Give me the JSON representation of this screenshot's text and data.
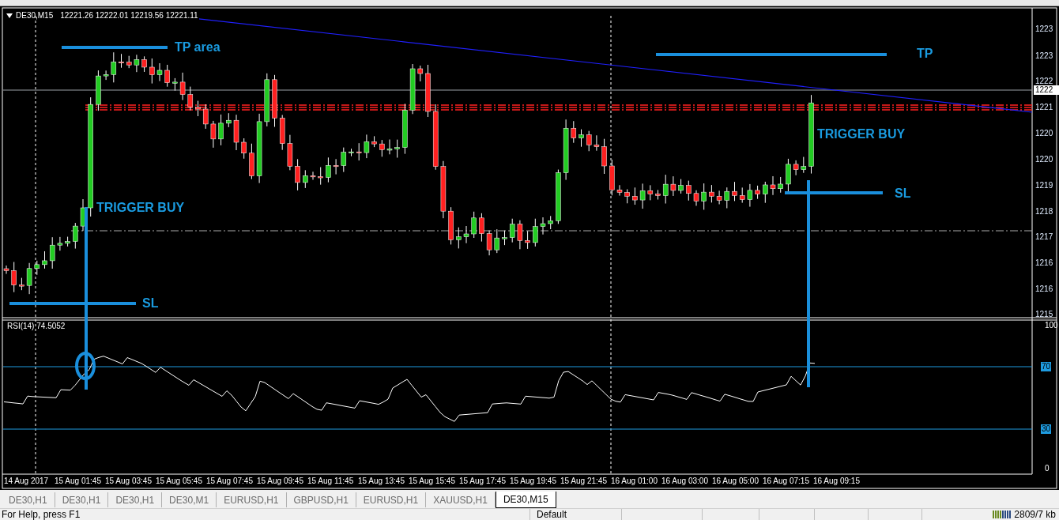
{
  "chart": {
    "symbol": "DE30,M15",
    "ohlc": "12221.26 12222.01 12219.56 12221.11",
    "price_axis": [
      {
        "label": "1223",
        "kind": "tick"
      },
      {
        "label": "1223",
        "kind": "tick"
      },
      {
        "label": "1222",
        "kind": "tick"
      },
      {
        "label": "1222",
        "kind": "current"
      },
      {
        "label": "1221",
        "kind": "tick"
      },
      {
        "label": "1220",
        "kind": "tick"
      },
      {
        "label": "1220",
        "kind": "tick"
      },
      {
        "label": "1219",
        "kind": "tick"
      },
      {
        "label": "1218",
        "kind": "tick"
      },
      {
        "label": "1217",
        "kind": "tick"
      },
      {
        "label": "1216",
        "kind": "tick"
      },
      {
        "label": "1216",
        "kind": "tick"
      },
      {
        "label": "1215",
        "kind": "tick"
      }
    ],
    "annotations": [
      {
        "text": "TP area"
      },
      {
        "text": "TP"
      },
      {
        "text": "TRIGGER BUY"
      },
      {
        "text": "TRIGGER BUY"
      },
      {
        "text": "SL"
      },
      {
        "text": "SL"
      }
    ]
  },
  "indicator": {
    "label": "RSI(14) 74.5052",
    "axis": [
      {
        "label": "100",
        "kind": "plain"
      },
      {
        "label": "70",
        "kind": "level"
      },
      {
        "label": "30",
        "kind": "level"
      },
      {
        "label": "0",
        "kind": "plain"
      }
    ]
  },
  "time_axis": [
    "14 Aug 2017",
    "15 Aug 01:45",
    "15 Aug 03:45",
    "15 Aug 05:45",
    "15 Aug 07:45",
    "15 Aug 09:45",
    "15 Aug 11:45",
    "15 Aug 13:45",
    "15 Aug 15:45",
    "15 Aug 17:45",
    "15 Aug 19:45",
    "15 Aug 21:45",
    "16 Aug 01:00",
    "16 Aug 03:00",
    "16 Aug 05:00",
    "16 Aug 07:15",
    "16 Aug 09:15"
  ],
  "tabs": [
    {
      "label": "DE30,H1",
      "selected": false
    },
    {
      "label": "DE30,H1",
      "selected": false
    },
    {
      "label": "DE30,H1",
      "selected": false
    },
    {
      "label": "DE30,M1",
      "selected": false
    },
    {
      "label": "EURUSD,H1",
      "selected": false
    },
    {
      "label": "GBPUSD,H1",
      "selected": false
    },
    {
      "label": "EURUSD,H1",
      "selected": false
    },
    {
      "label": "XAUUSD,H1",
      "selected": false
    },
    {
      "label": "DE30,M15",
      "selected": true
    }
  ],
  "status_bar": {
    "help": "For Help, press F1",
    "profile": "Default",
    "traffic": "2809/7 kb"
  }
}
